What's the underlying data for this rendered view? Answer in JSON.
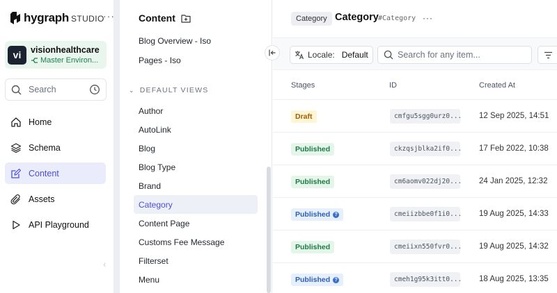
{
  "brand": {
    "name": "hygraph",
    "suffix": "STUDIO"
  },
  "project": {
    "initials": "vi",
    "name": "visionhealthcare",
    "environment": "Master Environ..."
  },
  "nav_search": {
    "label": "Search"
  },
  "nav": [
    {
      "label": "Home",
      "icon": "home-icon"
    },
    {
      "label": "Schema",
      "icon": "layers-icon"
    },
    {
      "label": "Content",
      "icon": "edit-icon",
      "active": true
    },
    {
      "label": "Assets",
      "icon": "paperclip-icon"
    },
    {
      "label": "API Playground",
      "icon": "play-icon"
    }
  ],
  "content_panel": {
    "title": "Content",
    "top_items": [
      "Blog Overview - Iso",
      "Pages - Iso"
    ],
    "section_label": "DEFAULT VIEWS",
    "views": [
      "Author",
      "AutoLink",
      "Blog",
      "Blog Type",
      "Brand",
      "Category",
      "Content Page",
      "Customs Fee Message",
      "Filterset",
      "Menu"
    ],
    "active_view": "Category"
  },
  "header": {
    "badge": "Category",
    "title": "Category",
    "api_id": "#Category"
  },
  "toolbar": {
    "locale_label": "Locale:",
    "locale_value": "Default",
    "search_placeholder": "Search for any item..."
  },
  "table": {
    "columns": [
      "Stages",
      "ID",
      "Created At"
    ],
    "rows": [
      {
        "stage": "Draft",
        "stage_type": "draft",
        "id": "cmfgu5sgg0urz0...",
        "created": "12 Sep 2025, 14:51"
      },
      {
        "stage": "Published",
        "stage_type": "published",
        "id": "ckzqsjblka2if0...",
        "created": "17 Feb 2022, 10:38"
      },
      {
        "stage": "Published",
        "stage_type": "published",
        "id": "cm6aomv022dj20...",
        "created": "24 Jan 2025, 12:32"
      },
      {
        "stage": "Published",
        "stage_type": "pubchanged",
        "id": "cmeiizbbe0f1i0...",
        "created": "19 Aug 2025, 14:33"
      },
      {
        "stage": "Published",
        "stage_type": "published",
        "id": "cmeiixn550fvr0...",
        "created": "19 Aug 2025, 14:32"
      },
      {
        "stage": "Published",
        "stage_type": "pubchanged",
        "id": "cmeh1g95k3itt0...",
        "created": "18 Aug 2025, 13:35"
      }
    ]
  },
  "colors": {
    "accent": "#4c4fd8",
    "project_bg": "#e9f6ee",
    "draft": "#a15c07",
    "published": "#1e7a45",
    "changed": "#2d5fb3"
  }
}
